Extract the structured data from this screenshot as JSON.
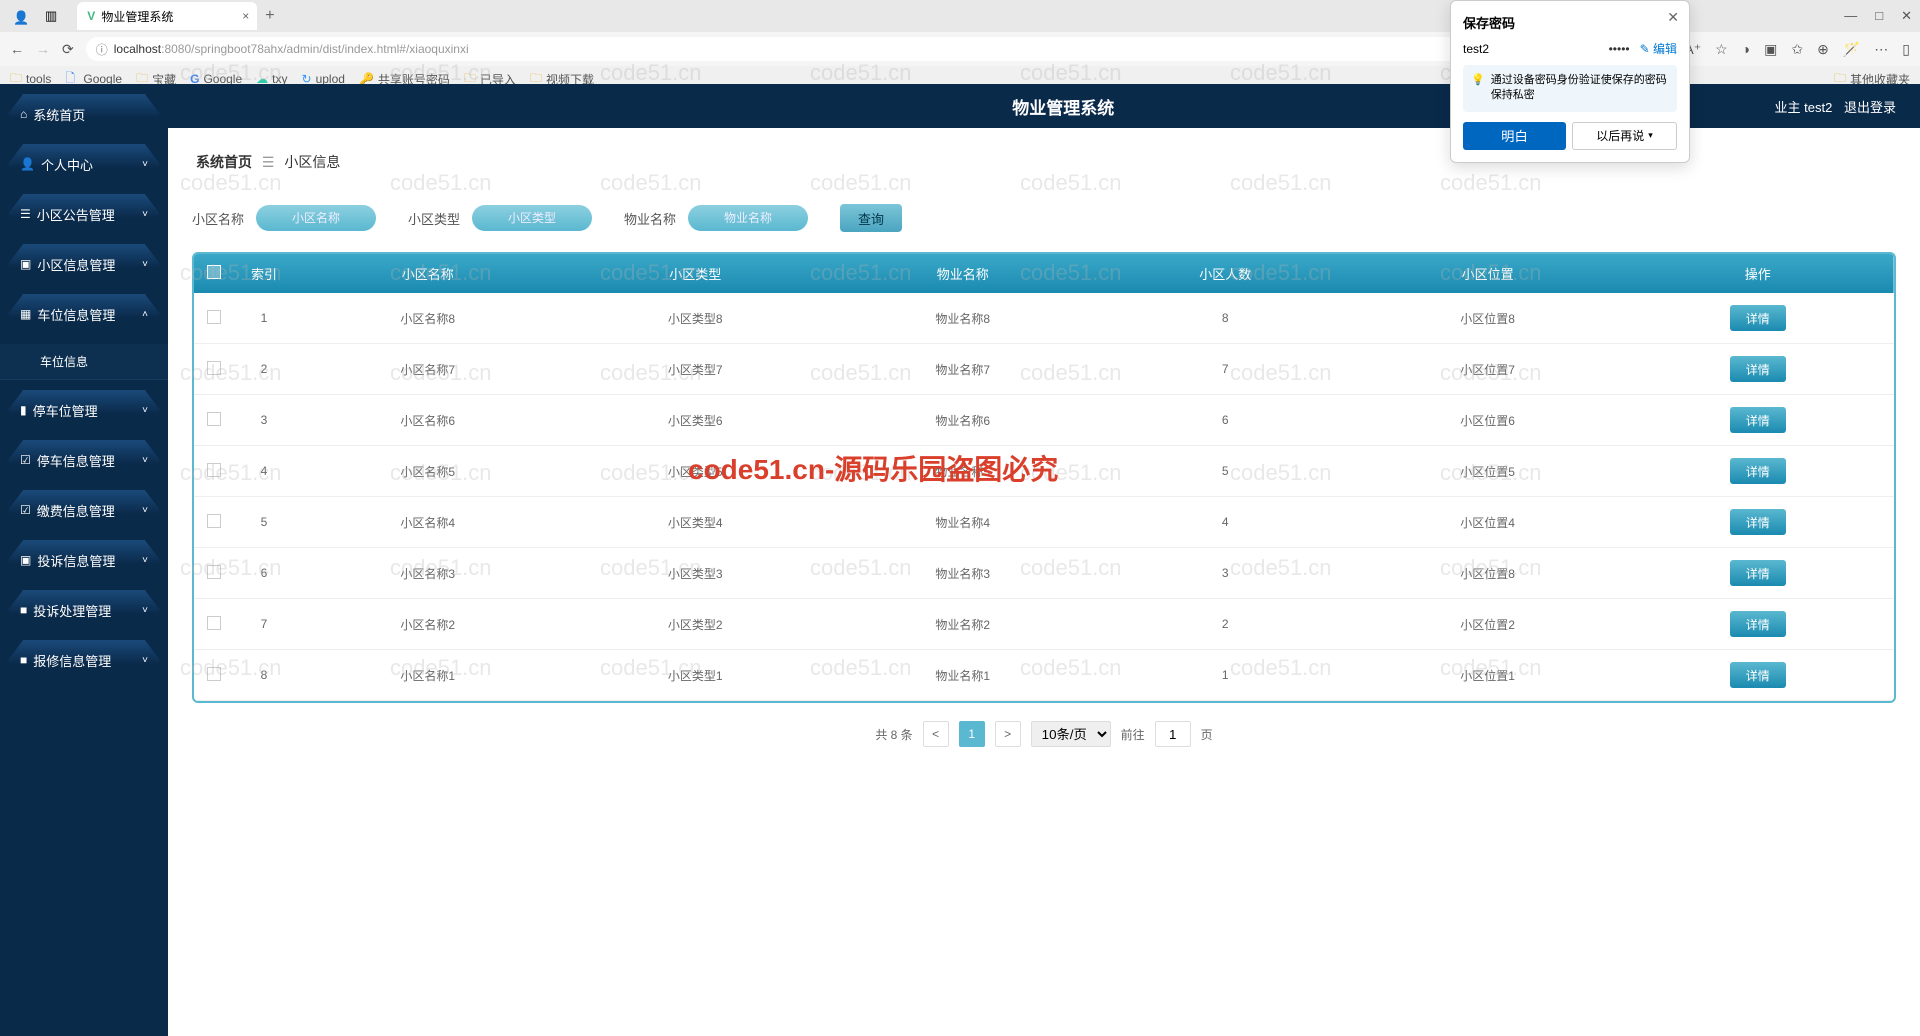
{
  "browser": {
    "tab_title": "物业管理系统",
    "url_proto": "localhost",
    "url_path": ":8080/springboot78ahx/admin/dist/index.html#/xiaoquxinxi",
    "new_tab": "+",
    "tab_close": "×",
    "win_min": "—",
    "win_max": "□",
    "win_close": "✕",
    "nav_back": "←",
    "nav_fwd": "→",
    "nav_refresh": "⟳",
    "bookmarks": [
      {
        "icon": "folder",
        "label": "tools"
      },
      {
        "icon": "g",
        "label": "Google"
      },
      {
        "icon": "folder",
        "label": "宝藏"
      },
      {
        "icon": "g",
        "label": "Google"
      },
      {
        "icon": "txy",
        "label": "txy"
      },
      {
        "icon": "up",
        "label": "uplod"
      },
      {
        "icon": "share",
        "label": "共享账号密码"
      },
      {
        "icon": "folder",
        "label": "已导入"
      },
      {
        "icon": "folder",
        "label": "视频下载"
      }
    ],
    "bm_other": "其他收藏夹"
  },
  "header": {
    "title": "物业管理系统",
    "user_role": "业主",
    "user_name": "test2",
    "logout": "退出登录"
  },
  "sidebar": [
    {
      "icon": "⌂",
      "label": "系统首页",
      "chevron": ""
    },
    {
      "icon": "👤",
      "label": "个人中心",
      "chevron": "˅"
    },
    {
      "icon": "☰",
      "label": "小区公告管理",
      "chevron": "˅"
    },
    {
      "icon": "▣",
      "label": "小区信息管理",
      "chevron": "˅"
    },
    {
      "icon": "▦",
      "label": "车位信息管理",
      "chevron": "˄",
      "sub": [
        {
          "label": "车位信息"
        }
      ]
    },
    {
      "icon": "▮",
      "label": "停车位管理",
      "chevron": "˅"
    },
    {
      "icon": "☑",
      "label": "停车信息管理",
      "chevron": "˅"
    },
    {
      "icon": "☑",
      "label": "缴费信息管理",
      "chevron": "˅"
    },
    {
      "icon": "▣",
      "label": "投诉信息管理",
      "chevron": "˅"
    },
    {
      "icon": "■",
      "label": "投诉处理管理",
      "chevron": "˅"
    },
    {
      "icon": "■",
      "label": "报修信息管理",
      "chevron": "˅"
    }
  ],
  "breadcrumb": {
    "home": "系统首页",
    "sep": "☰",
    "current": "小区信息"
  },
  "search": {
    "labels": [
      "小区名称",
      "小区类型",
      "物业名称"
    ],
    "placeholders": [
      "小区名称",
      "小区类型",
      "物业名称"
    ],
    "button": "查询"
  },
  "table": {
    "headers": [
      "",
      "索引",
      "小区名称",
      "小区类型",
      "物业名称",
      "小区人数",
      "小区位置",
      "操作"
    ],
    "rows": [
      {
        "idx": "1",
        "name": "小区名称8",
        "type": "小区类型8",
        "prop": "物业名称8",
        "people": "8",
        "loc": "小区位置8"
      },
      {
        "idx": "2",
        "name": "小区名称7",
        "type": "小区类型7",
        "prop": "物业名称7",
        "people": "7",
        "loc": "小区位置7"
      },
      {
        "idx": "3",
        "name": "小区名称6",
        "type": "小区类型6",
        "prop": "物业名称6",
        "people": "6",
        "loc": "小区位置6"
      },
      {
        "idx": "4",
        "name": "小区名称5",
        "type": "小区类型5",
        "prop": "物业名称5",
        "people": "5",
        "loc": "小区位置5"
      },
      {
        "idx": "5",
        "name": "小区名称4",
        "type": "小区类型4",
        "prop": "物业名称4",
        "people": "4",
        "loc": "小区位置4"
      },
      {
        "idx": "6",
        "name": "小区名称3",
        "type": "小区类型3",
        "prop": "物业名称3",
        "people": "3",
        "loc": "小区位置8"
      },
      {
        "idx": "7",
        "name": "小区名称2",
        "type": "小区类型2",
        "prop": "物业名称2",
        "people": "2",
        "loc": "小区位置2"
      },
      {
        "idx": "8",
        "name": "小区名称1",
        "type": "小区类型1",
        "prop": "物业名称1",
        "people": "1",
        "loc": "小区位置1"
      }
    ],
    "detail_label": "详情"
  },
  "pagination": {
    "total": "共 8 条",
    "prev": "<",
    "pages": [
      "1"
    ],
    "next": ">",
    "per_page": "10条/页",
    "jump_label": "前往",
    "jump_value": "1",
    "jump_suffix": "页"
  },
  "pwd_popup": {
    "title": "保存密码",
    "user": "test2",
    "pwd": "•••••",
    "edit": "✎ 编辑",
    "hint": "通过设备密码身份验证使保存的密码保持私密",
    "ok": "明白",
    "later": "以后再说"
  },
  "watermark": "code51.cn-源码乐园盗图必究",
  "watermark_light": "code51.cn"
}
